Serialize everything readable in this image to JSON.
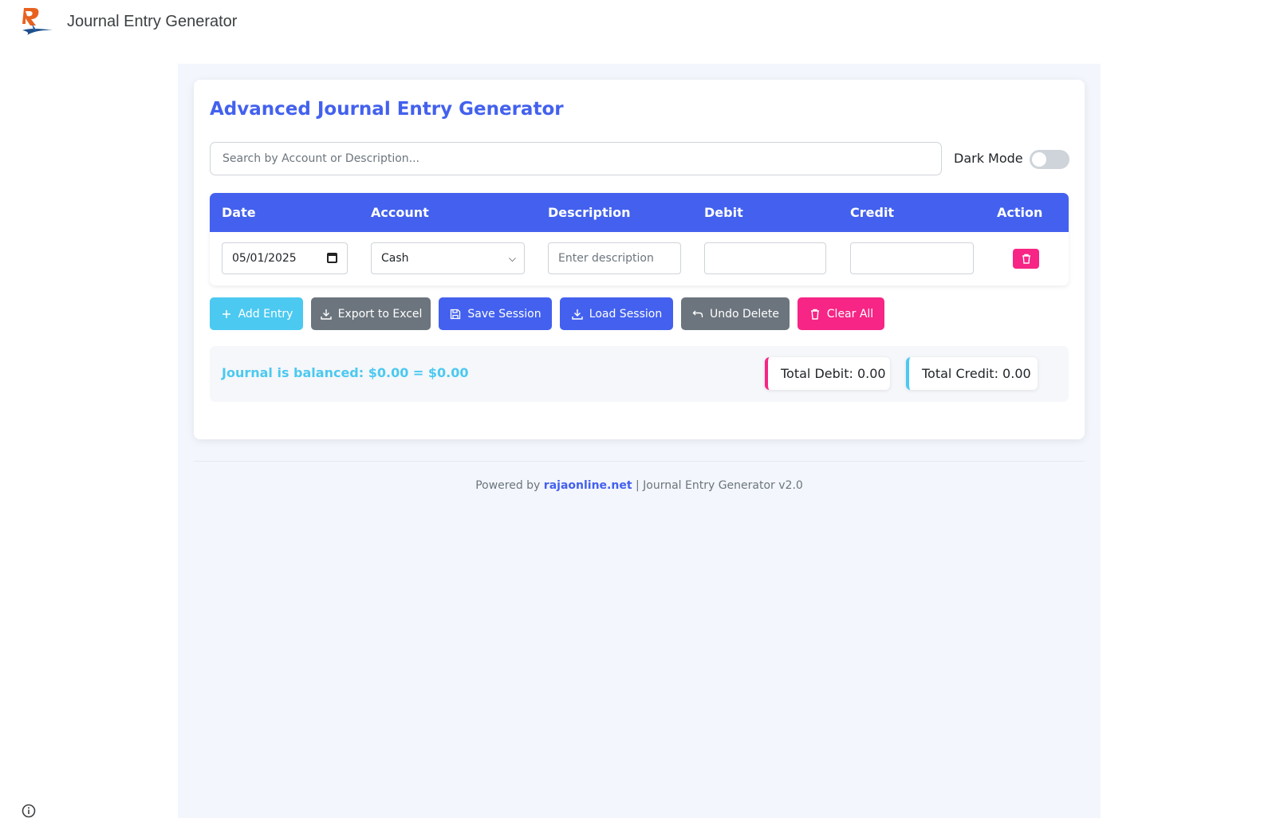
{
  "header": {
    "site_title": "Journal Entry Generator"
  },
  "main": {
    "title": "Advanced Journal Entry Generator",
    "search": {
      "placeholder": "Search by Account or Description..."
    },
    "dark_mode": {
      "label": "Dark Mode",
      "enabled": false
    }
  },
  "table": {
    "columns": [
      "Date",
      "Account",
      "Description",
      "Debit",
      "Credit",
      "Action"
    ],
    "rows": [
      {
        "date": "05/01/2025",
        "account": "Cash",
        "description_placeholder": "Enter description",
        "debit": "",
        "credit": "",
        "action_icon": "trash-icon"
      }
    ]
  },
  "actions": {
    "add_entry": "Add Entry",
    "export_excel": "Export to Excel",
    "save_session": "Save Session",
    "load_session": "Load Session",
    "undo_delete": "Undo Delete",
    "clear_all": "Clear All"
  },
  "summary": {
    "balance_text": "Journal is balanced: $0.00 = $0.00",
    "total_debit": "Total Debit: 0.00",
    "total_credit": "Total Credit: 0.00"
  },
  "footer": {
    "prefix": "Powered by",
    "link_text": "rajaonline.net",
    "suffix": "| Journal Entry Generator v2.0"
  },
  "colors": {
    "primary": "#4361ee",
    "info": "#4cc9f0",
    "danger": "#f72585",
    "secondary": "#6c757d",
    "stage_bg": "#f3f6fc"
  }
}
